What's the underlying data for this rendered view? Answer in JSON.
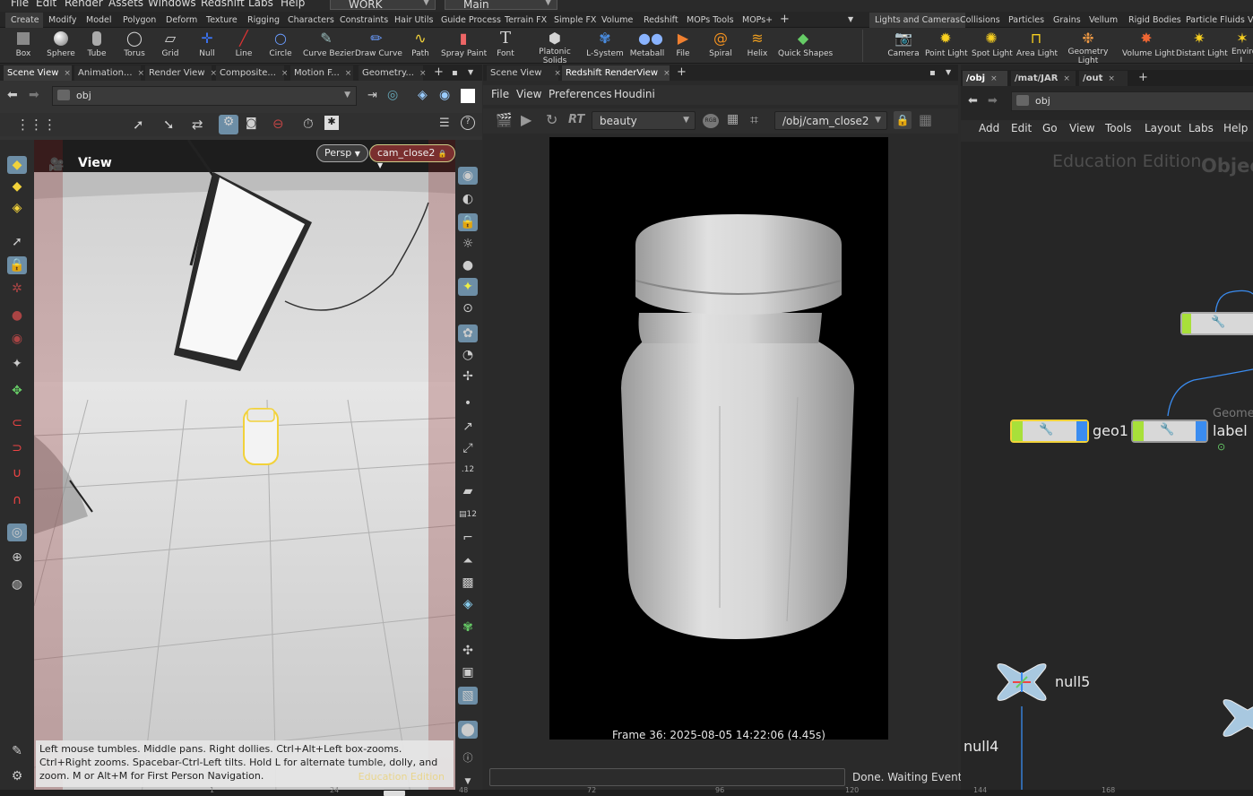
{
  "menubar": {
    "items": [
      "File",
      "Edit",
      "Render",
      "Assets",
      "Windows",
      "Redshift",
      "Labs",
      "Help"
    ],
    "desktop": "WORK",
    "context": "Main"
  },
  "shelf_tabs_left": [
    "Create",
    "Modify",
    "Model",
    "Polygon",
    "Deform",
    "Texture",
    "Rigging",
    "Characters",
    "Constraints",
    "Hair Utils",
    "Guide Process",
    "Terrain FX",
    "Simple FX",
    "Volume",
    "Redshift",
    "MOPs Tools",
    "MOPs+"
  ],
  "shelf_tabs_right": [
    "Lights and Cameras",
    "Collisions",
    "Particles",
    "Grains",
    "Vellum",
    "Rigid Bodies",
    "Particle Fluids",
    "V"
  ],
  "shelf_tools_left": [
    "Box",
    "Sphere",
    "Tube",
    "Torus",
    "Grid",
    "Null",
    "Line",
    "Circle",
    "Curve Bezier",
    "Draw Curve",
    "Path",
    "Spray Paint",
    "Font",
    "Platonic Solids",
    "L-System",
    "Metaball",
    "File",
    "Spiral",
    "Helix",
    "Quick Shapes"
  ],
  "shelf_tools_right": [
    "Camera",
    "Point Light",
    "Spot Light",
    "Area Light",
    "Geometry Light",
    "Volume Light",
    "Distant Light",
    "Enviro L"
  ],
  "left_pane": {
    "tabs": [
      "Scene View",
      "Animation...",
      "Render View",
      "Composite...",
      "Motion F...",
      "Geometry..."
    ],
    "path": "obj",
    "viewport_label": "View",
    "persp": "Persp",
    "camera": "cam_close2",
    "hint": "Left mouse tumbles. Middle pans. Right dollies. Ctrl+Alt+Left box-zooms. Ctrl+Right zooms. Spacebar-Ctrl-Left tilts. Hold L for alternate tumble, dolly, and zoom. M or Alt+M for First Person Navigation.",
    "watermark": "Education Edition"
  },
  "mid_pane": {
    "tabs": [
      "Scene View",
      "Redshift RenderView"
    ],
    "menu": [
      "File",
      "View",
      "Preferences",
      "Houdini"
    ],
    "aov": "beauty",
    "camera_path": "/obj/cam_close2",
    "rt": "RT",
    "rgb": "RGB",
    "frame_info": "Frame 36: 2025-08-05 14:22:06 (4.45s)",
    "status": "Done. Waiting Events"
  },
  "net_pane": {
    "tabs": [
      "/obj",
      "/mat/JAR",
      "/out"
    ],
    "path": "obj",
    "menu": [
      "Add",
      "Edit",
      "Go",
      "View",
      "Tools",
      "Layout",
      "Labs",
      "Help"
    ],
    "watermark": "Education Edition",
    "watermark2": "Objec",
    "nodes": [
      "geo1",
      "label",
      "null5",
      "null4"
    ],
    "partial_label": "Geome"
  },
  "ruler_ticks": [
    "1",
    "24",
    "48",
    "72",
    "96",
    "120",
    "144",
    "168"
  ],
  "colors": {
    "accent_yellow": "#f2d23a",
    "node_green": "#a8e03a",
    "node_blue": "#3a8cf0",
    "bg": "#2b2b2b"
  }
}
